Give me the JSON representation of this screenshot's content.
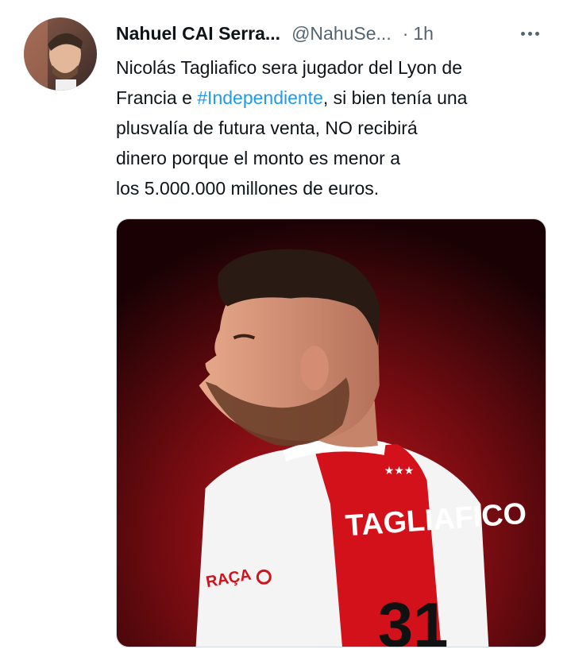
{
  "tweet": {
    "display_name": "Nahuel CAI Serra...",
    "handle": "@NahuSe...",
    "separator": "·",
    "time": "1h",
    "text_before": "Nicolás Tagliafico sera jugador del Lyon de\nFrancia e ",
    "hashtag": "#Independiente",
    "text_after": ", si bien tenía una\nplusvalía de futura venta, NO recibirá\ndinero porque el monto es menor a\nlos 5.000.000 millones de euros.",
    "more_icon": "more-horizontal-icon"
  },
  "media": {
    "jersey_name": "TAGLIAFICO",
    "jersey_stars": "★★★",
    "jersey_sponsor": "RAÇA",
    "jersey_number": "31"
  },
  "colors": {
    "link": "#1d9bf0",
    "secondary_text": "#536471",
    "primary_text": "#0f1419"
  }
}
